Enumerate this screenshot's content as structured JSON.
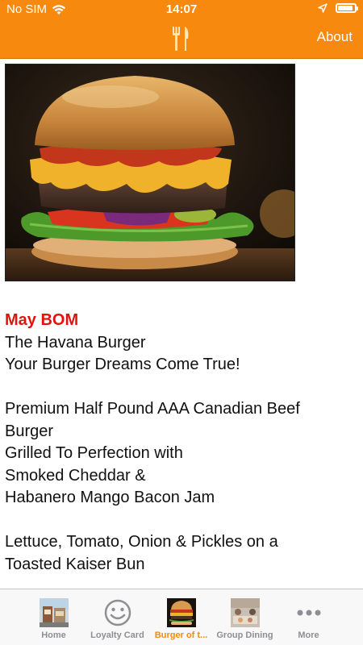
{
  "status_bar": {
    "carrier": "No SIM",
    "time": "14:07",
    "battery_level": 0.9
  },
  "nav": {
    "logo_icon": "fork-knife-icon",
    "about_label": "About"
  },
  "promo": {
    "heading": "May BOM",
    "lines": [
      "The Havana Burger",
      "Your Burger Dreams Come True!",
      "",
      "Premium Half Pound AAA Canadian Beef",
      "Burger",
      "Grilled To Perfection with",
      "Smoked Cheddar &",
      "Habanero Mango Bacon Jam",
      "",
      "Lettuce, Tomato, Onion & Pickles on a",
      "Toasted Kaiser Bun"
    ]
  },
  "tabs": [
    {
      "label": "Home",
      "icon": "restaurant-photo-icon",
      "active": false
    },
    {
      "label": "Loyalty Card",
      "icon": "smiley-face-icon",
      "active": false
    },
    {
      "label": "Burger of t...",
      "icon": "burger-photo-icon",
      "active": true
    },
    {
      "label": "Group Dining",
      "icon": "dining-photo-icon",
      "active": false
    },
    {
      "label": "More",
      "icon": "more-dots-icon",
      "active": false
    }
  ],
  "colors": {
    "accent": "#f7890f",
    "heading_red": "#e0130f",
    "tab_inactive": "#8e8e93"
  }
}
